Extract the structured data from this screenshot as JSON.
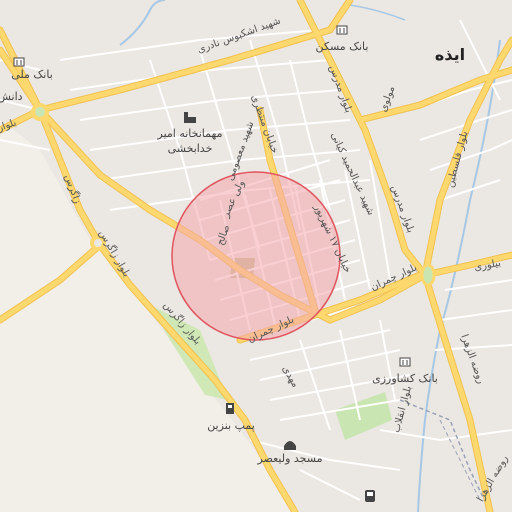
{
  "map": {
    "city_label": "ایذه",
    "pois": [
      {
        "name": "بانک مسکن",
        "icon": "bank-icon"
      },
      {
        "name": "بانک ملی",
        "icon": "bank-icon"
      },
      {
        "name": "دانش",
        "icon": ""
      },
      {
        "name": "مهمانخانه امیر",
        "icon": "hotel-icon"
      },
      {
        "name": "خدابخشی",
        "icon": ""
      },
      {
        "name": "بانک کشاورزی",
        "icon": "bank-icon"
      },
      {
        "name": "پمپ بنزین",
        "icon": "fuel-icon"
      },
      {
        "name": "مسجد ولیعصر",
        "icon": "mosque-icon"
      },
      {
        "name": "",
        "icon": "bus-icon"
      }
    ],
    "streets": [
      "شهید اشکبوس نادری",
      "بلوار مدرس",
      "مولوی",
      "بلوار فلسطین",
      "شهید عبدالحمید کیانی",
      "بلوار مدرس",
      "بلوار چمران",
      "بیلوری",
      "خیابان ۱۷ شهریور",
      "زاگرس",
      "بلوار زاگرس",
      "بلوار زاگرس",
      "ولی عصر",
      "صالح",
      "شهید معصومی",
      "خیابان منتظری",
      "بلوار چمران",
      "بلوار انقلاب",
      "روضه الزهرا",
      "روضه الزهرا",
      "مهدی",
      "بلوار"
    ],
    "colors": {
      "background": "#f2efe9",
      "major_road": "#fcd86f",
      "minor_road": "#ffffff",
      "water": "#a6c8e6",
      "park": "#c9e6b2",
      "highlight_fill": "#f4a7ad",
      "highlight_stroke": "#e0555f",
      "railway": "#9aa2b6"
    }
  }
}
